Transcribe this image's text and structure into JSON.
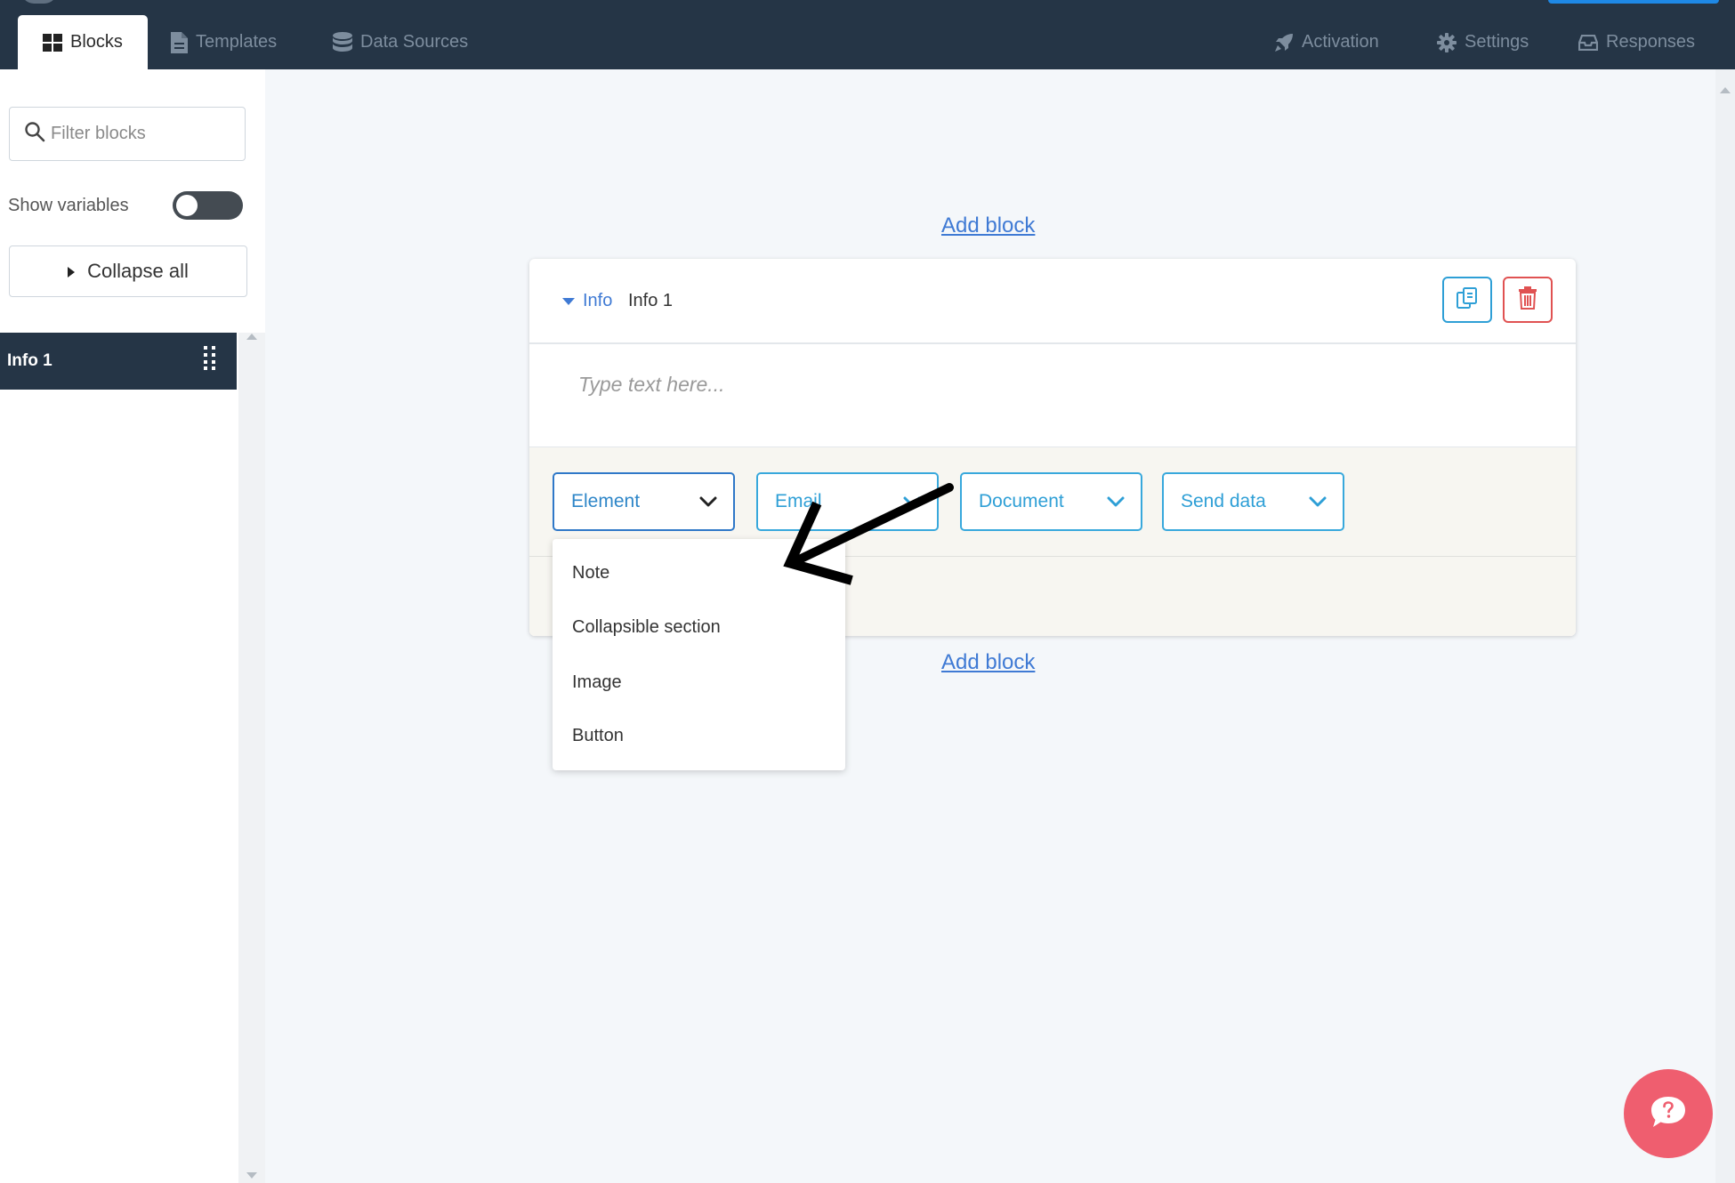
{
  "nav": {
    "tabs": [
      {
        "label": "Blocks",
        "icon": "grid-icon",
        "active": true
      },
      {
        "label": "Templates",
        "icon": "file-icon"
      },
      {
        "label": "Data Sources",
        "icon": "database-icon"
      }
    ],
    "right_tabs": [
      {
        "label": "Activation",
        "icon": "rocket-icon"
      },
      {
        "label": "Settings",
        "icon": "gear-icon"
      },
      {
        "label": "Responses",
        "icon": "inbox-icon"
      }
    ]
  },
  "sidebar": {
    "filter_placeholder": "Filter blocks",
    "show_variables_label": "Show variables",
    "show_variables_on": false,
    "collapse_all_label": "Collapse all",
    "items": [
      {
        "label": "Info 1"
      }
    ]
  },
  "canvas": {
    "add_block_label": "Add block",
    "block": {
      "type_label": "Info",
      "title": "Info 1",
      "body_placeholder": "Type text here...",
      "dropdowns": [
        {
          "label": "Element",
          "open": true
        },
        {
          "label": "Email"
        },
        {
          "label": "Document"
        },
        {
          "label": "Send data"
        }
      ],
      "element_menu": [
        "Note",
        "Collapsible section",
        "Image",
        "Button"
      ]
    }
  },
  "colors": {
    "navbar": "#253546",
    "accent": "#2e9fd6",
    "link": "#3f7ad4",
    "danger": "#e05252",
    "help": "#ef5e6f"
  }
}
